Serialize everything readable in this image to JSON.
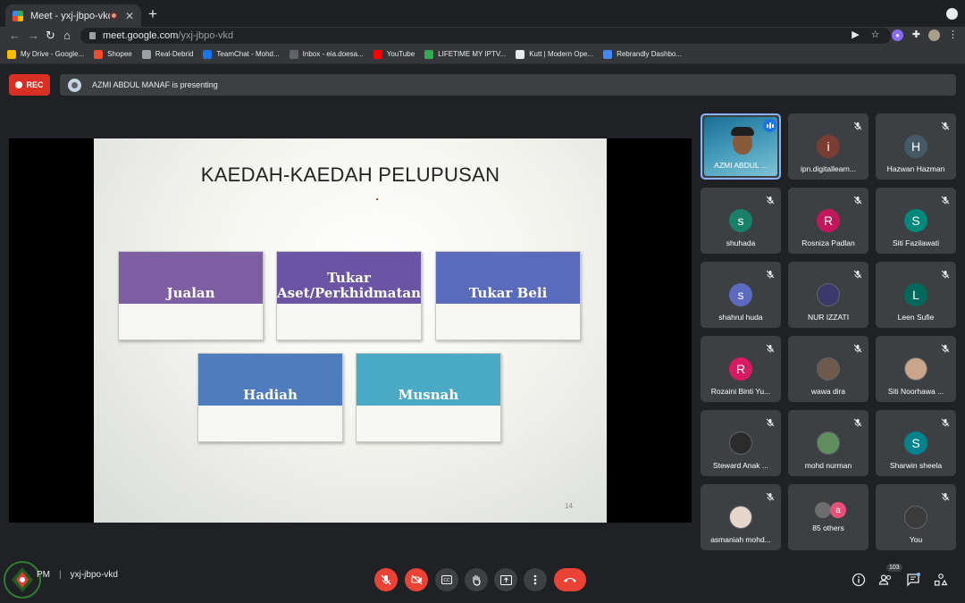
{
  "browser": {
    "tab_title": "Meet - yxj-jbpo-vkd",
    "url_host": "meet.google.com",
    "url_path": "/yxj-jbpo-vkd",
    "bookmarks": [
      {
        "label": "My Drive - Google...",
        "color": "#fbbc04"
      },
      {
        "label": "Shopee",
        "color": "#ee4d2d"
      },
      {
        "label": "Real-Debrid",
        "color": "#9aa0a6"
      },
      {
        "label": "TeamChat - Mohd...",
        "color": "#1a73e8"
      },
      {
        "label": "Inbox - eia.doesa...",
        "color": "#5f6368"
      },
      {
        "label": "YouTube",
        "color": "#ff0000"
      },
      {
        "label": "LIFETIME MY IPTV...",
        "color": "#34a853"
      },
      {
        "label": "Kutt | Modern Ope...",
        "color": "#e8eaed"
      },
      {
        "label": "Rebrandly Dashbo...",
        "color": "#4285f4"
      }
    ]
  },
  "meet": {
    "rec_label": "REC",
    "presenting_text": "AZMI ABDUL MANAF is presenting",
    "time_label": "PM",
    "meeting_code": "yxj-jbpo-vkd",
    "participant_count": "103"
  },
  "slide": {
    "title": "KAEDAH-KAEDAH PELUPUSAN",
    "page_number": "14",
    "cards": [
      {
        "label": "Jualan",
        "color": "#7e5fa3"
      },
      {
        "label": "Tukar Aset/Perkhidmatan",
        "color": "#6a54a3"
      },
      {
        "label": "Tukar Beli",
        "color": "#5b6bbb"
      },
      {
        "label": "Hadiah",
        "color": "#4f7cbf"
      },
      {
        "label": "Musnah",
        "color": "#4aaac6"
      }
    ]
  },
  "participants": [
    {
      "name": "AZMI ABDUL ...",
      "initial": "",
      "color": "",
      "type": "video"
    },
    {
      "name": "ipn.digitallearn...",
      "initial": "i",
      "color": "#7a3d33",
      "type": "letter"
    },
    {
      "name": "Hazwan Hazman",
      "initial": "H",
      "color": "#455a64",
      "type": "letter"
    },
    {
      "name": "shuhada",
      "initial": "s",
      "color": "#188068",
      "type": "letter"
    },
    {
      "name": "Rosniza Padlan",
      "initial": "R",
      "color": "#c2185b",
      "type": "letter"
    },
    {
      "name": "Siti Fazilawati",
      "initial": "S",
      "color": "#00897b",
      "type": "letter"
    },
    {
      "name": "shahrul huda",
      "initial": "s",
      "color": "#5c6bc0",
      "type": "letter"
    },
    {
      "name": "NUR IZZATI",
      "initial": "",
      "color": "#3a3a6a",
      "type": "photo"
    },
    {
      "name": "Leen Sufie",
      "initial": "L",
      "color": "#00695c",
      "type": "letter"
    },
    {
      "name": "Rozaini Binti Yu...",
      "initial": "R",
      "color": "#d81b60",
      "type": "letter"
    },
    {
      "name": "wawa dira",
      "initial": "",
      "color": "#6d5a4a",
      "type": "photo"
    },
    {
      "name": "Siti Noorhawa ...",
      "initial": "",
      "color": "#caa58a",
      "type": "photo"
    },
    {
      "name": "Steward Anak ...",
      "initial": "",
      "color": "#2b2b2b",
      "type": "photo"
    },
    {
      "name": "mohd nurman",
      "initial": "",
      "color": "#5f8f5f",
      "type": "photo"
    },
    {
      "name": "Sharwin sheela",
      "initial": "S",
      "color": "#00838f",
      "type": "letter"
    },
    {
      "name": "asmaniah mohd...",
      "initial": "",
      "color": "#e6d6cc",
      "type": "photo"
    },
    {
      "name": "85 others",
      "initial": "a",
      "color": "#e8507a",
      "type": "others"
    },
    {
      "name": "You",
      "initial": "",
      "color": "#3b3b3b",
      "type": "photo"
    }
  ]
}
